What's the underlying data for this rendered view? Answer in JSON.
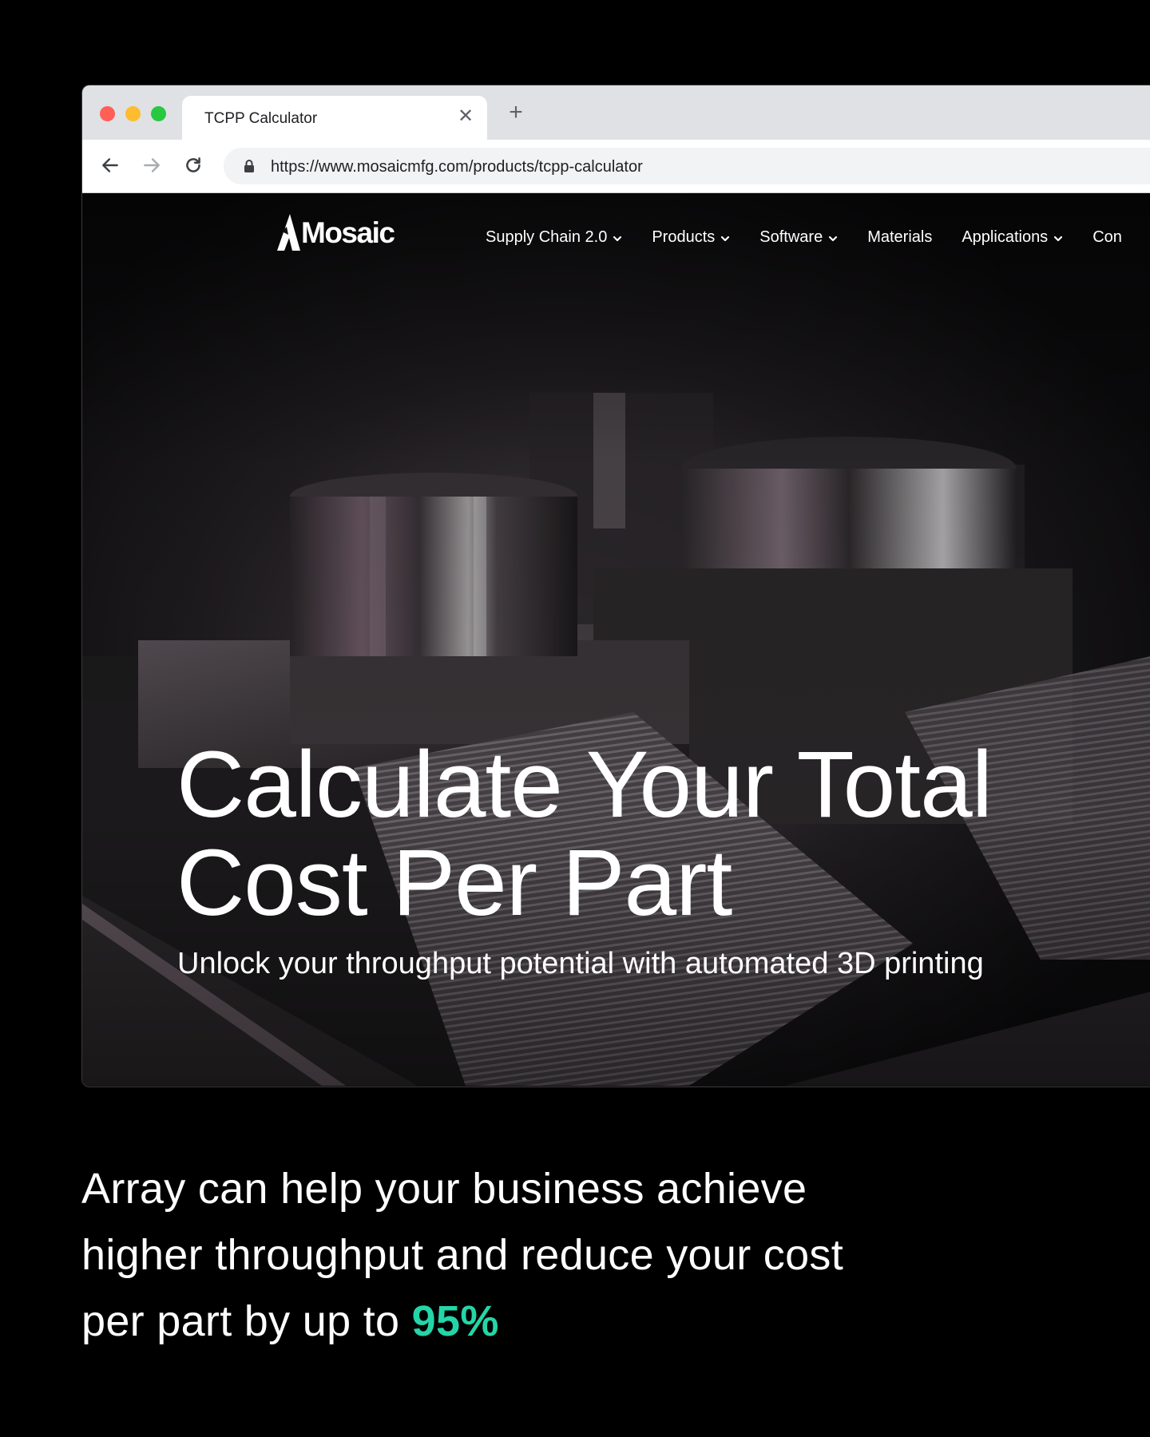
{
  "browser": {
    "tab_title": "TCPP Calculator",
    "url": "https://www.mosaicmfg.com/products/tcpp-calculator"
  },
  "site": {
    "logo_text": "Mosaic",
    "nav": [
      {
        "label": "Supply Chain 2.0",
        "has_dropdown": true
      },
      {
        "label": "Products",
        "has_dropdown": true
      },
      {
        "label": "Software",
        "has_dropdown": true
      },
      {
        "label": "Materials",
        "has_dropdown": false
      },
      {
        "label": "Applications",
        "has_dropdown": true
      },
      {
        "label": "Con",
        "has_dropdown": false
      }
    ],
    "hero": {
      "title_line1": "Calculate Your Total",
      "title_line2": "Cost Per Part",
      "subtitle": "Unlock your throughput potential with automated 3D printing"
    }
  },
  "caption": {
    "text": "Array can help your business achieve higher throughput and reduce your cost per part by up to ",
    "highlight": "95%",
    "highlight_color": "#24d6a7"
  },
  "icons": [
    "back-arrow-icon",
    "forward-arrow-icon",
    "reload-icon",
    "lock-icon",
    "close-icon",
    "plus-icon",
    "chevron-down-icon"
  ]
}
